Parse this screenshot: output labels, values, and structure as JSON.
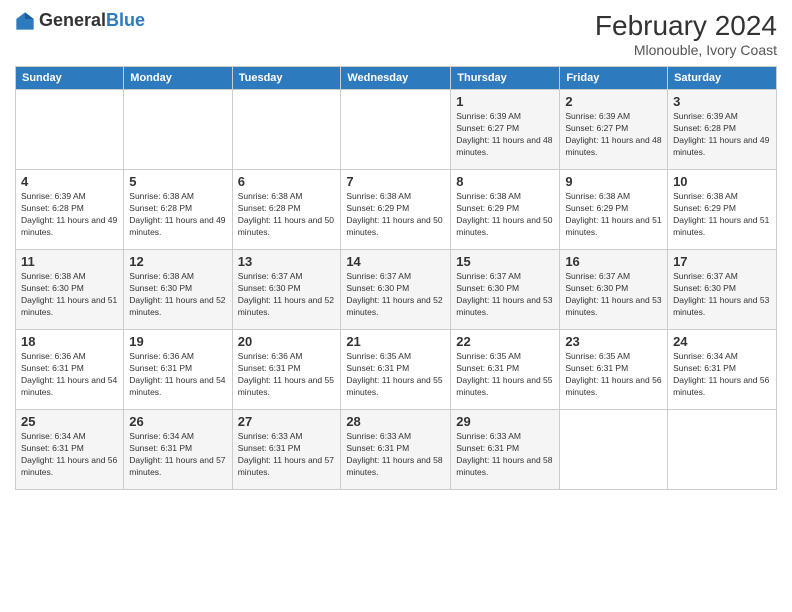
{
  "header": {
    "logo_general": "General",
    "logo_blue": "Blue",
    "title": "February 2024",
    "location": "Mlonouble, Ivory Coast"
  },
  "weekdays": [
    "Sunday",
    "Monday",
    "Tuesday",
    "Wednesday",
    "Thursday",
    "Friday",
    "Saturday"
  ],
  "weeks": [
    [
      {
        "day": "",
        "info": ""
      },
      {
        "day": "",
        "info": ""
      },
      {
        "day": "",
        "info": ""
      },
      {
        "day": "",
        "info": ""
      },
      {
        "day": "1",
        "info": "Sunrise: 6:39 AM\nSunset: 6:27 PM\nDaylight: 11 hours and 48 minutes."
      },
      {
        "day": "2",
        "info": "Sunrise: 6:39 AM\nSunset: 6:27 PM\nDaylight: 11 hours and 48 minutes."
      },
      {
        "day": "3",
        "info": "Sunrise: 6:39 AM\nSunset: 6:28 PM\nDaylight: 11 hours and 49 minutes."
      }
    ],
    [
      {
        "day": "4",
        "info": "Sunrise: 6:39 AM\nSunset: 6:28 PM\nDaylight: 11 hours and 49 minutes."
      },
      {
        "day": "5",
        "info": "Sunrise: 6:38 AM\nSunset: 6:28 PM\nDaylight: 11 hours and 49 minutes."
      },
      {
        "day": "6",
        "info": "Sunrise: 6:38 AM\nSunset: 6:28 PM\nDaylight: 11 hours and 50 minutes."
      },
      {
        "day": "7",
        "info": "Sunrise: 6:38 AM\nSunset: 6:29 PM\nDaylight: 11 hours and 50 minutes."
      },
      {
        "day": "8",
        "info": "Sunrise: 6:38 AM\nSunset: 6:29 PM\nDaylight: 11 hours and 50 minutes."
      },
      {
        "day": "9",
        "info": "Sunrise: 6:38 AM\nSunset: 6:29 PM\nDaylight: 11 hours and 51 minutes."
      },
      {
        "day": "10",
        "info": "Sunrise: 6:38 AM\nSunset: 6:29 PM\nDaylight: 11 hours and 51 minutes."
      }
    ],
    [
      {
        "day": "11",
        "info": "Sunrise: 6:38 AM\nSunset: 6:30 PM\nDaylight: 11 hours and 51 minutes."
      },
      {
        "day": "12",
        "info": "Sunrise: 6:38 AM\nSunset: 6:30 PM\nDaylight: 11 hours and 52 minutes."
      },
      {
        "day": "13",
        "info": "Sunrise: 6:37 AM\nSunset: 6:30 PM\nDaylight: 11 hours and 52 minutes."
      },
      {
        "day": "14",
        "info": "Sunrise: 6:37 AM\nSunset: 6:30 PM\nDaylight: 11 hours and 52 minutes."
      },
      {
        "day": "15",
        "info": "Sunrise: 6:37 AM\nSunset: 6:30 PM\nDaylight: 11 hours and 53 minutes."
      },
      {
        "day": "16",
        "info": "Sunrise: 6:37 AM\nSunset: 6:30 PM\nDaylight: 11 hours and 53 minutes."
      },
      {
        "day": "17",
        "info": "Sunrise: 6:37 AM\nSunset: 6:30 PM\nDaylight: 11 hours and 53 minutes."
      }
    ],
    [
      {
        "day": "18",
        "info": "Sunrise: 6:36 AM\nSunset: 6:31 PM\nDaylight: 11 hours and 54 minutes."
      },
      {
        "day": "19",
        "info": "Sunrise: 6:36 AM\nSunset: 6:31 PM\nDaylight: 11 hours and 54 minutes."
      },
      {
        "day": "20",
        "info": "Sunrise: 6:36 AM\nSunset: 6:31 PM\nDaylight: 11 hours and 55 minutes."
      },
      {
        "day": "21",
        "info": "Sunrise: 6:35 AM\nSunset: 6:31 PM\nDaylight: 11 hours and 55 minutes."
      },
      {
        "day": "22",
        "info": "Sunrise: 6:35 AM\nSunset: 6:31 PM\nDaylight: 11 hours and 55 minutes."
      },
      {
        "day": "23",
        "info": "Sunrise: 6:35 AM\nSunset: 6:31 PM\nDaylight: 11 hours and 56 minutes."
      },
      {
        "day": "24",
        "info": "Sunrise: 6:34 AM\nSunset: 6:31 PM\nDaylight: 11 hours and 56 minutes."
      }
    ],
    [
      {
        "day": "25",
        "info": "Sunrise: 6:34 AM\nSunset: 6:31 PM\nDaylight: 11 hours and 56 minutes."
      },
      {
        "day": "26",
        "info": "Sunrise: 6:34 AM\nSunset: 6:31 PM\nDaylight: 11 hours and 57 minutes."
      },
      {
        "day": "27",
        "info": "Sunrise: 6:33 AM\nSunset: 6:31 PM\nDaylight: 11 hours and 57 minutes."
      },
      {
        "day": "28",
        "info": "Sunrise: 6:33 AM\nSunset: 6:31 PM\nDaylight: 11 hours and 58 minutes."
      },
      {
        "day": "29",
        "info": "Sunrise: 6:33 AM\nSunset: 6:31 PM\nDaylight: 11 hours and 58 minutes."
      },
      {
        "day": "",
        "info": ""
      },
      {
        "day": "",
        "info": ""
      }
    ]
  ]
}
